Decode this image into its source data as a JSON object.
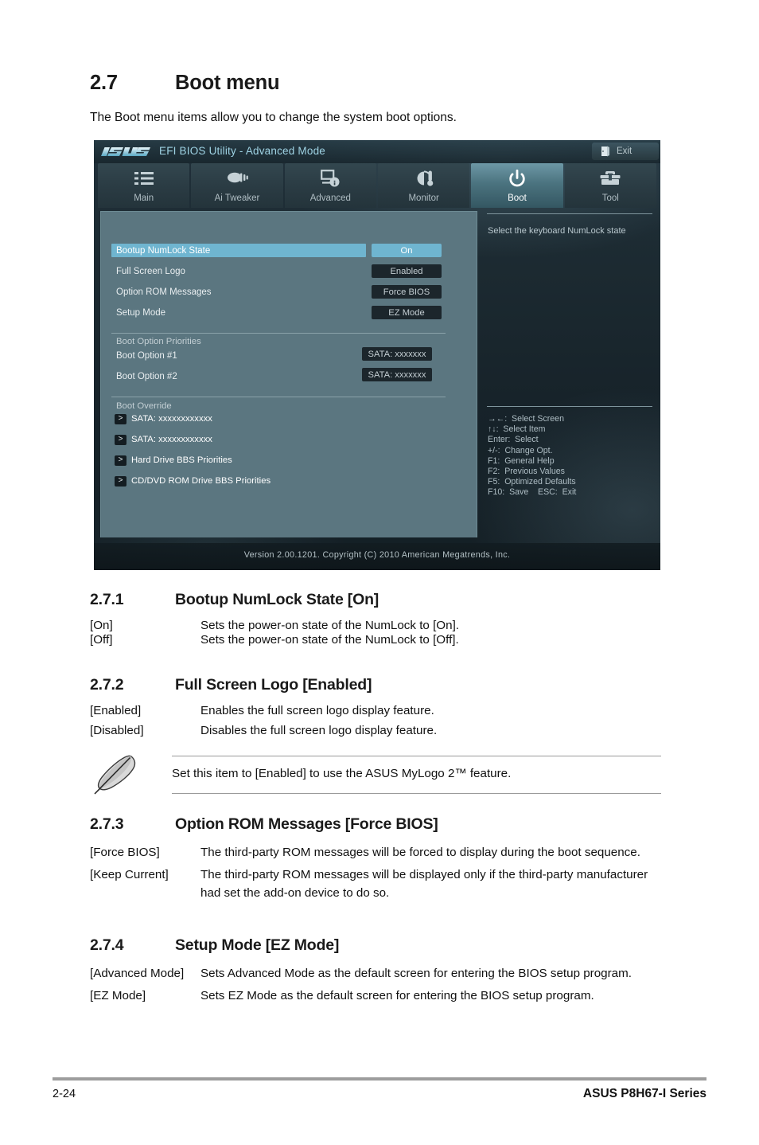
{
  "section": {
    "number": "2.7",
    "title": "Boot menu",
    "intro": "The Boot menu items allow you to change the system boot options."
  },
  "bios": {
    "logo": "asus-logo",
    "title": "EFI BIOS Utility - Advanced Mode",
    "exit_label": "Exit",
    "tabs": [
      {
        "label": "Main",
        "icon": "list-icon",
        "active": false
      },
      {
        "label": "Ai  Tweaker",
        "icon": "tweaker-icon",
        "active": false
      },
      {
        "label": "Advanced",
        "icon": "advanced-info-icon",
        "active": false
      },
      {
        "label": "Monitor",
        "icon": "thermometer-icon",
        "active": false
      },
      {
        "label": "Boot",
        "icon": "power-icon",
        "active": true
      },
      {
        "label": "Tool",
        "icon": "toolbox-icon",
        "active": false
      }
    ],
    "settings": [
      {
        "label": "Bootup NumLock State",
        "value": "On",
        "selected": true
      },
      {
        "label": "Full Screen Logo",
        "value": "Enabled",
        "selected": false
      },
      {
        "label": "Option ROM Messages",
        "value": "Force BIOS",
        "selected": false
      },
      {
        "label": "Setup Mode",
        "value": "EZ Mode",
        "selected": false
      }
    ],
    "boot_priorities": {
      "title": "Boot Option Priorities",
      "items": [
        {
          "label": "Boot Option #1",
          "value": "SATA: xxxxxxx"
        },
        {
          "label": "Boot Option #2",
          "value": "SATA: xxxxxxx"
        }
      ]
    },
    "boot_override": {
      "title": "Boot Override",
      "items": [
        {
          "arrow": ">",
          "label": "SATA: xxxxxxxxxxxx"
        },
        {
          "arrow": ">",
          "label": "SATA: xxxxxxxxxxxx"
        },
        {
          "arrow": ">",
          "label": "Hard Drive BBS Priorities"
        },
        {
          "arrow": ">",
          "label": "CD/DVD ROM Drive BBS Priorities"
        }
      ]
    },
    "help_text": "Select the keyboard NumLock state",
    "key_legend": [
      "→←:  Select Screen",
      "↑↓:  Select Item",
      "Enter:  Select",
      "+/-:  Change Opt.",
      "F1:  General Help",
      "F2:  Previous Values",
      "F5:  Optimized Defaults",
      "F10:  Save    ESC:  Exit"
    ],
    "version_line": "Version  2.00.1201.   Copyright  (C)  2010  American  Megatrends,  Inc.",
    "colors": {
      "highlight": "#6fb5d0",
      "panel": "#5b7680",
      "title_accent": "#9fd3e4",
      "value_box": "#1c262c"
    }
  },
  "subsections": [
    {
      "number": "2.7.1",
      "title": "Bootup NumLock State [On]",
      "rows": [
        {
          "term": "[On]",
          "desc": "Sets the power-on state of the NumLock to [On]."
        },
        {
          "term": "[Off]",
          "desc": "Sets the power-on state of the NumLock to [Off]."
        }
      ]
    },
    {
      "number": "2.7.2",
      "title": "Full Screen Logo [Enabled]",
      "rows": [
        {
          "term": "[Enabled]",
          "desc": "Enables the full screen logo display feature."
        },
        {
          "term": "[Disabled]",
          "desc": "Disables the full screen logo display feature."
        }
      ]
    },
    {
      "number": "2.7.3",
      "title": "Option ROM Messages [Force BIOS]",
      "rows": [
        {
          "term": "[Force BIOS]",
          "desc": "The third-party ROM messages will be forced to display during the boot sequence."
        },
        {
          "term": "[Keep Current]",
          "desc": "The third-party ROM messages will be displayed only if the third-party manufacturer had set the add-on device to do so."
        }
      ]
    },
    {
      "number": "2.7.4",
      "title": "Setup Mode [EZ Mode]",
      "rows": [
        {
          "term": "[Advanced Mode]",
          "desc": "Sets Advanced Mode as the default screen for entering the BIOS setup program."
        },
        {
          "term": "[EZ Mode]",
          "desc": "Sets EZ Mode as the default screen for entering the BIOS setup program."
        }
      ]
    }
  ],
  "note": {
    "icon": "pencil-icon",
    "text": "Set this item to [Enabled] to use the ASUS MyLogo 2™ feature."
  },
  "footer": {
    "page_number": "2-24",
    "product": "ASUS P8H67-I Series"
  }
}
